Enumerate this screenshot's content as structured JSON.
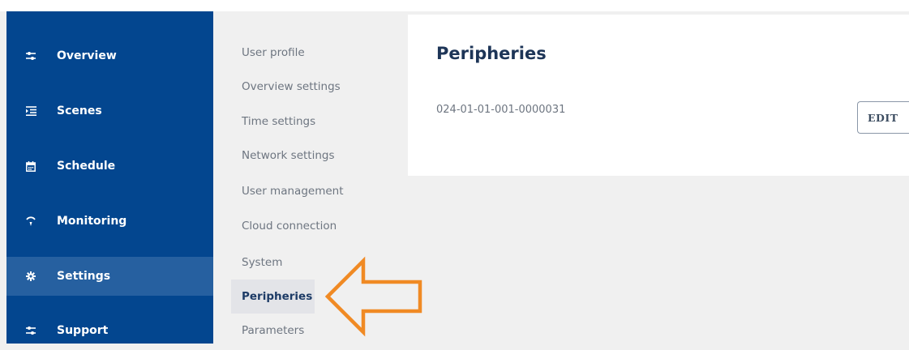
{
  "sidebar": {
    "items": [
      {
        "label": "Overview",
        "icon": "sliders-icon",
        "active": false
      },
      {
        "label": "Scenes",
        "icon": "list-indent-icon",
        "active": false
      },
      {
        "label": "Schedule",
        "icon": "calendar-icon",
        "active": false
      },
      {
        "label": "Monitoring",
        "icon": "signal-icon",
        "active": false
      },
      {
        "label": "Settings",
        "icon": "gear-icon",
        "active": true
      },
      {
        "label": "Support",
        "icon": "sliders-icon",
        "active": false
      }
    ]
  },
  "submenu": {
    "items": [
      {
        "label": "User profile"
      },
      {
        "label": "Overview settings"
      },
      {
        "label": "Time settings"
      },
      {
        "label": "Network settings"
      },
      {
        "label": "User management"
      },
      {
        "label": "Cloud connection"
      },
      {
        "label": "System"
      },
      {
        "label": "Peripheries",
        "active": true
      },
      {
        "label": "Parameters"
      }
    ]
  },
  "panel": {
    "title": "Peripheries",
    "device_id": "024-01-01-001-0000031",
    "edit_label": "EDIT"
  },
  "colors": {
    "sidebar_bg": "#03468f",
    "sidebar_active": "#2660a0",
    "annotation_arrow": "#f08a24"
  }
}
